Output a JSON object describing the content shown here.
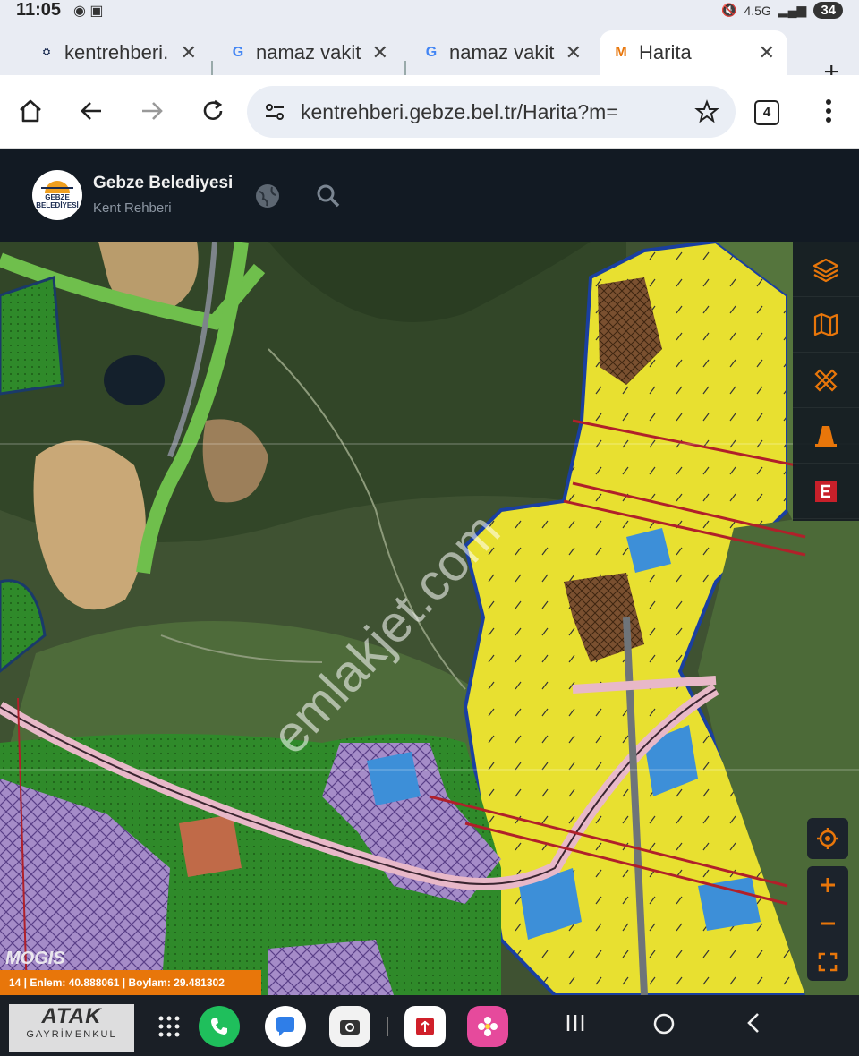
{
  "status": {
    "time": "11:05",
    "network": "4.5G",
    "battery": "34"
  },
  "tabs": [
    {
      "title": "kentrehberi.",
      "favicon": "gebze-favicon"
    },
    {
      "title": "namaz vakit",
      "favicon": "google-favicon"
    },
    {
      "title": "namaz vakit",
      "favicon": "google-favicon"
    },
    {
      "title": "Harita",
      "favicon": "mogis-favicon"
    }
  ],
  "browser": {
    "url": "kentrehberi.gebze.bel.tr/Harita?m=",
    "tab_count": "4"
  },
  "app": {
    "title": "Gebze Belediyesi",
    "subtitle": "Kent Rehberi",
    "logo_text": "GEBZE BELEDİYESİ"
  },
  "map": {
    "watermark": "emlakjet.com",
    "brand": "MOGIS",
    "coords": "14 | Enlem: 40.888061 | Boylam: 29.481302"
  },
  "side_tools": [
    "layers-icon",
    "map-icon",
    "measure-icon",
    "cone-icon",
    "e-icon"
  ],
  "overlay": {
    "logo_line1": "ATAK",
    "logo_line2": "GAYRİMENKUL"
  },
  "colors": {
    "accent": "#e8760a",
    "zone_yellow": "#e8e030",
    "zone_purple": "#a58cc8",
    "zone_blue": "#3d8fd8",
    "zone_green": "#2f8a2a"
  }
}
